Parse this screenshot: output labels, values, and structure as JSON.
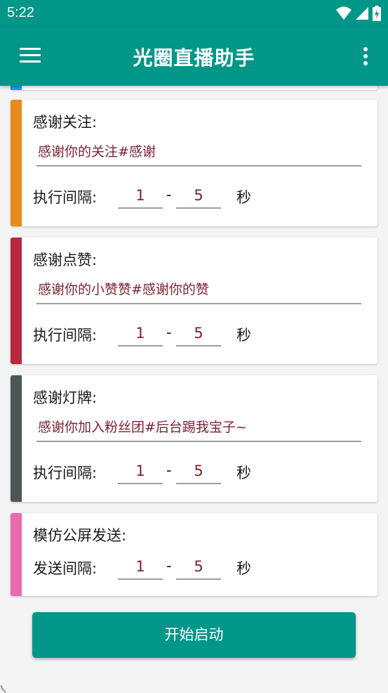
{
  "status_bar": {
    "time": "5:22",
    "icons": [
      "wifi-icon",
      "signal-icon",
      "battery-charging-icon"
    ]
  },
  "app_bar": {
    "title": "光圈直播助手",
    "left_icon": "menu-icon",
    "right_icon": "more-vert-icon"
  },
  "colors": {
    "primary": "#009688",
    "text_value": "#7b2233",
    "strip_partial": "#2196f3"
  },
  "cards": [
    {
      "title": "感谢关注:",
      "message": "感谢你的关注#感谢",
      "interval_label": "执行间隔:",
      "min": "1",
      "dash": "-",
      "max": "5",
      "unit": "秒",
      "strip_color": "#e68a1c"
    },
    {
      "title": "感谢点赞:",
      "message": "感谢你的小赞赞#感谢你的赞",
      "interval_label": "执行间隔:",
      "min": "1",
      "dash": "-",
      "max": "5",
      "unit": "秒",
      "strip_color": "#b5283f"
    },
    {
      "title": "感谢灯牌:",
      "message": "感谢你加入粉丝团#后台踢我宝子~",
      "interval_label": "执行间隔:",
      "min": "1",
      "dash": "-",
      "max": "5",
      "unit": "秒",
      "strip_color": "#4c5557"
    },
    {
      "title": "模仿公屏发送:",
      "interval_label": "发送间隔:",
      "min": "1",
      "dash": "-",
      "max": "5",
      "unit": "秒",
      "strip_color": "#ea6aad"
    }
  ],
  "start_button": {
    "label": "开始启动"
  }
}
